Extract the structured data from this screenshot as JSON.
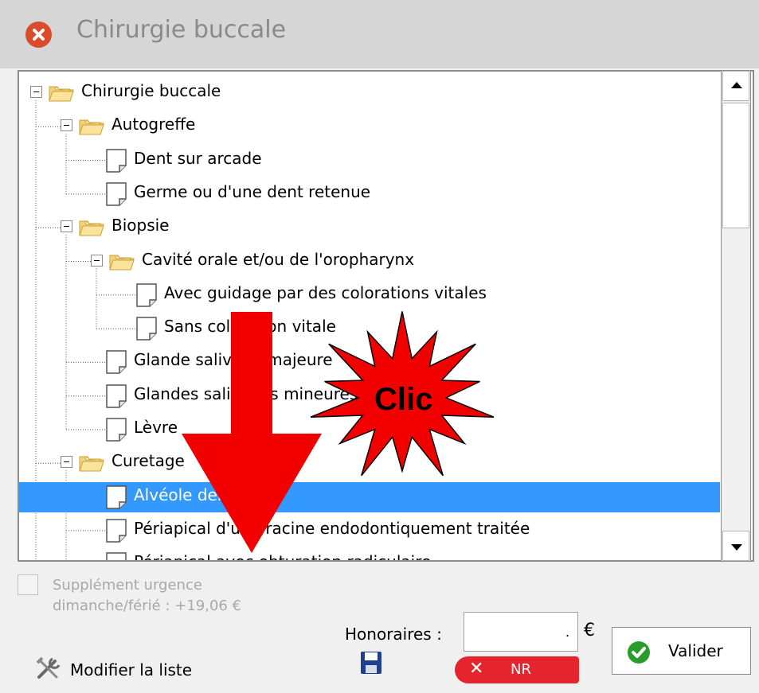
{
  "window": {
    "title": "Chirurgie buccale"
  },
  "tree": {
    "rows": [
      {
        "label": "Chirurgie buccale",
        "type": "folder"
      },
      {
        "label": "Autogreffe",
        "type": "folder"
      },
      {
        "label": "Dent sur arcade",
        "type": "doc"
      },
      {
        "label": "Germe ou d'une dent retenue",
        "type": "doc"
      },
      {
        "label": "Biopsie",
        "type": "folder"
      },
      {
        "label": "Cavité orale et/ou de l'oropharynx",
        "type": "folder"
      },
      {
        "label": "Avec guidage par des colorations vitales",
        "type": "doc"
      },
      {
        "label": "Sans coloration vitale",
        "type": "doc"
      },
      {
        "label": "Glande salivaire majeure",
        "type": "doc"
      },
      {
        "label": "Glandes salivaires mineures",
        "type": "doc"
      },
      {
        "label": "Lèvre",
        "type": "doc"
      },
      {
        "label": "Curetage",
        "type": "folder"
      },
      {
        "label": "Alvéole dentaire",
        "type": "doc",
        "selected": true
      },
      {
        "label": "Périapical d'une racine endodontiquement traitée",
        "type": "doc"
      },
      {
        "label": "Périapical avec obturation radiculaire",
        "type": "doc"
      }
    ]
  },
  "urgence": {
    "line1": "Supplément urgence",
    "line2": "dimanche/férié : +19,06 €",
    "checked": false
  },
  "honoraires": {
    "label": "Honoraires :",
    "value": ".",
    "currency": "€"
  },
  "buttons": {
    "valider": "Valider",
    "modifier": "Modifier la liste",
    "nr": "NR",
    "nr_x": "✕"
  },
  "annotation": {
    "text": "Clic",
    "starColor": "#f20000",
    "arrowColor": "#f20000"
  },
  "colors": {
    "selection": "#3399ff",
    "close": "#d94b2b",
    "valider": "#2b9b2b",
    "nr": "#e4252d"
  }
}
